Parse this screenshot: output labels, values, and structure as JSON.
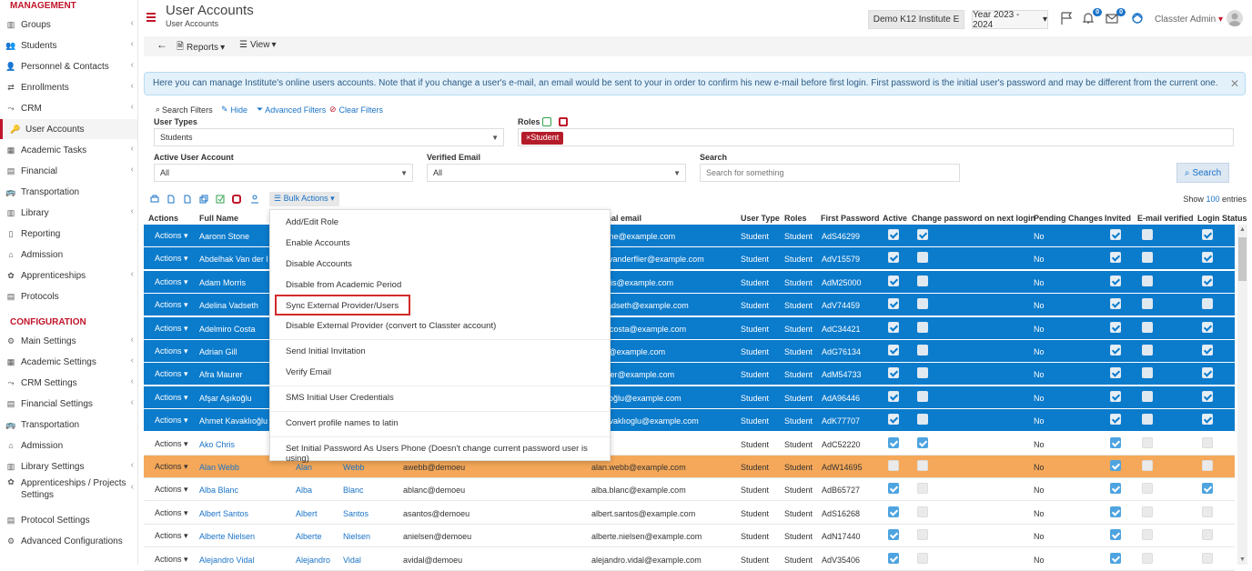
{
  "sidebar": {
    "section_management": "MANAGEMENT",
    "section_configuration": "CONFIGURATION",
    "management_items": [
      {
        "label": "Groups",
        "icon": "groups-icon"
      },
      {
        "label": "Students",
        "icon": "students-icon"
      },
      {
        "label": "Personnel & Contacts",
        "icon": "personnel-icon"
      },
      {
        "label": "Enrollments",
        "icon": "enrollments-icon"
      },
      {
        "label": "CRM",
        "icon": "crm-icon"
      },
      {
        "label": "User Accounts",
        "icon": "key-icon"
      },
      {
        "label": "Academic Tasks",
        "icon": "tasks-icon"
      },
      {
        "label": "Financial",
        "icon": "financial-icon"
      },
      {
        "label": "Transportation",
        "icon": "bus-icon"
      },
      {
        "label": "Library",
        "icon": "library-icon"
      },
      {
        "label": "Reporting",
        "icon": "reporting-icon"
      },
      {
        "label": "Admission",
        "icon": "admission-icon"
      },
      {
        "label": "Apprenticeships",
        "icon": "apprenticeships-icon"
      },
      {
        "label": "Protocols",
        "icon": "protocols-icon"
      }
    ],
    "config_items": [
      {
        "label": "Main Settings",
        "icon": "settings-icon"
      },
      {
        "label": "Academic Settings",
        "icon": "academic-settings-icon"
      },
      {
        "label": "CRM Settings",
        "icon": "crm-icon"
      },
      {
        "label": "Financial Settings",
        "icon": "financial-icon"
      },
      {
        "label": "Transportation",
        "icon": "bus-icon"
      },
      {
        "label": "Admission",
        "icon": "admission-icon"
      },
      {
        "label": "Library Settings",
        "icon": "library-icon"
      },
      {
        "label": "Apprenticeships / Projects Settings",
        "icon": "apprenticeships-icon"
      },
      {
        "label": "Protocol Settings",
        "icon": "protocols-icon"
      },
      {
        "label": "Advanced Configurations",
        "icon": "gear-icon"
      }
    ]
  },
  "header": {
    "title": "User Accounts",
    "breadcrumb": "User Accounts",
    "institute": "Demo K12 Institute E",
    "year": "Year 2023 - 2024",
    "notif_count": "0",
    "mail_count": "0",
    "user": "Classter Admin"
  },
  "toolbar": {
    "reports": "Reports",
    "view": "View"
  },
  "alert": {
    "text": "Here you can manage Institute's online users accounts. Note that if you change a user's e-mail, an email would be sent to your in order to confirm his new e-mail before first login. First password is the initial user's password and may be different from the current one."
  },
  "filters": {
    "search_filters": "Search Filters",
    "hide": "Hide",
    "advanced": "Advanced Filters",
    "clear": "Clear Filters",
    "user_types_label": "User Types",
    "user_types_value": "Students",
    "roles_label": "Roles",
    "role_tag": "Student",
    "active_label": "Active User Account",
    "active_value": "All",
    "verified_label": "Verified Email",
    "verified_value": "All",
    "search_label": "Search",
    "search_placeholder": "Search for something",
    "search_button": "Search"
  },
  "table_toolbar": {
    "bulk_actions": "Bulk Actions",
    "show": "Show",
    "show_count": "100",
    "entries": "entries"
  },
  "columns": {
    "actions": "Actions",
    "full_name": "Full Name",
    "personal_email": "onal email",
    "user_type": "User Type",
    "roles": "Roles",
    "first_password": "First Password",
    "active": "Active",
    "change_pw": "Change password on next login",
    "pending": "Pending Changes",
    "invited": "Invited",
    "email_verified": "E-mail verified",
    "login_status": "Login Status"
  },
  "rows": [
    {
      "actions": "Actions",
      "full_name": "Aaronn Stone",
      "first": "",
      "last": "",
      "username": "",
      "email": "n.stone@example.com",
      "user_type": "Student",
      "roles": "Student",
      "password": "AdS46299",
      "pending": "No"
    },
    {
      "actions": "Actions",
      "full_name": "Abdelhak Van der l",
      "first": "",
      "last": "",
      "username": "",
      "email": "lhak.vanderflier@example.com",
      "user_type": "Student",
      "roles": "Student",
      "password": "AdV15579",
      "pending": "No"
    },
    {
      "actions": "Actions",
      "full_name": "Adam Morris",
      "first": "",
      "last": "",
      "username": "",
      "email": ".morris@example.com",
      "user_type": "Student",
      "roles": "Student",
      "password": "AdM25000",
      "pending": "No"
    },
    {
      "actions": "Actions",
      "full_name": "Adelina Vadseth",
      "first": "",
      "last": "",
      "username": "",
      "email": "na.vadseth@example.com",
      "user_type": "Student",
      "roles": "Student",
      "password": "AdV74459",
      "pending": "No"
    },
    {
      "actions": "Actions",
      "full_name": "Adelmiro Costa",
      "first": "",
      "last": "",
      "username": "",
      "email": "miro.costa@example.com",
      "user_type": "Student",
      "roles": "Student",
      "password": "AdC34421",
      "pending": "No"
    },
    {
      "actions": "Actions",
      "full_name": "Adrian Gill",
      "first": "",
      "last": "",
      "username": "",
      "email": "n.gill@example.com",
      "user_type": "Student",
      "roles": "Student",
      "password": "AdG76134",
      "pending": "No"
    },
    {
      "actions": "Actions",
      "full_name": "Afra Maurer",
      "first": "",
      "last": "",
      "username": "",
      "email": "maurer@example.com",
      "user_type": "Student",
      "roles": "Student",
      "password": "AdM54733",
      "pending": "No"
    },
    {
      "actions": "Actions",
      "full_name": "Afşar Aşıkoğlu",
      "first": "",
      "last": "",
      "username": "",
      "email": ".aşıkoğlu@example.com",
      "user_type": "Student",
      "roles": "Student",
      "password": "AdA96446",
      "pending": "No"
    },
    {
      "actions": "Actions",
      "full_name": "Ahmet Kavaklıoğlu",
      "first": "",
      "last": "",
      "username": "",
      "email": "et.kavaklıoglu@example.com",
      "user_type": "Student",
      "roles": "Student",
      "password": "AdK77707",
      "pending": "No"
    },
    {
      "actions": "Actions",
      "full_name": "Ako Chris",
      "first": "",
      "last": "",
      "username": "",
      "email": "",
      "user_type": "Student",
      "roles": "Student",
      "password": "AdC52220",
      "pending": "No"
    },
    {
      "actions": "Actions",
      "full_name": "Alan Webb",
      "first": "Alan",
      "last": "Webb",
      "username": "awebb@demoeu",
      "email": "alan.webb@example.com",
      "user_type": "Student",
      "roles": "Student",
      "password": "AdW14695",
      "pending": "No"
    },
    {
      "actions": "Actions",
      "full_name": "Alba Blanc",
      "first": "Alba",
      "last": "Blanc",
      "username": "ablanc@demoeu",
      "email": "alba.blanc@example.com",
      "user_type": "Student",
      "roles": "Student",
      "password": "AdB65727",
      "pending": "No"
    },
    {
      "actions": "Actions",
      "full_name": "Albert Santos",
      "first": "Albert",
      "last": "Santos",
      "username": "asantos@demoeu",
      "email": "albert.santos@example.com",
      "user_type": "Student",
      "roles": "Student",
      "password": "AdS16268",
      "pending": "No"
    },
    {
      "actions": "Actions",
      "full_name": "Alberte Nielsen",
      "first": "Alberte",
      "last": "Nielsen",
      "username": "anielsen@demoeu",
      "email": "alberte.nielsen@example.com",
      "user_type": "Student",
      "roles": "Student",
      "password": "AdN17440",
      "pending": "No"
    },
    {
      "actions": "Actions",
      "full_name": "Alejandro Vidal",
      "first": "Alejandro",
      "last": "Vidal",
      "username": "avidal@demoeu",
      "email": "alejandro.vidal@example.com",
      "user_type": "Student",
      "roles": "Student",
      "password": "AdV35406",
      "pending": "No"
    }
  ],
  "bulk_menu": [
    "Add/Edit Role",
    "Enable Accounts",
    "Disable Accounts",
    "Disable from Academic Period",
    "Sync External Provider/Users",
    "Disable External Provider (convert to Classter account)",
    "Send Initial Invitation",
    "Verify Email",
    "SMS Initial User Credentials",
    "Convert profile names to latin",
    "Set Initial Password As Users Phone (Doesn't change current password user is using)"
  ],
  "colors": {
    "brand_red": "#c0152a",
    "selected_row": "#0b7bcc",
    "highlight_row": "#f5a859",
    "link_blue": "#1a73c7"
  }
}
